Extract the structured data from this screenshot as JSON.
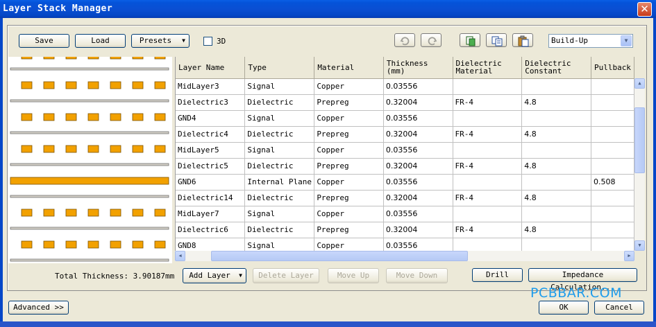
{
  "window": {
    "title": "Layer Stack Manager",
    "close": "✕"
  },
  "toolbar": {
    "save": "Save",
    "load": "Load",
    "presets": "Presets",
    "three_d": "3D",
    "mode": "Build-Up",
    "icons": [
      "undo-icon",
      "redo-icon",
      "copy-icon",
      "paste-icon",
      "clipboard-icon"
    ]
  },
  "grid": {
    "columns": [
      "Layer Name",
      "Type",
      "Material",
      "Thickness (mm)",
      "Dielectric Material",
      "Dielectric Constant",
      "Pullback"
    ],
    "rows": [
      [
        "MidLayer3",
        "Signal",
        "Copper",
        "0.03556",
        "",
        "",
        ""
      ],
      [
        "Dielectric3",
        "Dielectric",
        "Prepreg",
        "0.32004",
        "FR-4",
        "4.8",
        ""
      ],
      [
        "GND4",
        "Signal",
        "Copper",
        "0.03556",
        "",
        "",
        ""
      ],
      [
        "Dielectric4",
        "Dielectric",
        "Prepreg",
        "0.32004",
        "FR-4",
        "4.8",
        ""
      ],
      [
        "MidLayer5",
        "Signal",
        "Copper",
        "0.03556",
        "",
        "",
        ""
      ],
      [
        "Dielectric5",
        "Dielectric",
        "Prepreg",
        "0.32004",
        "FR-4",
        "4.8",
        ""
      ],
      [
        "GND6",
        "Internal Plane",
        "Copper",
        "0.03556",
        "",
        "",
        "0.508"
      ],
      [
        "Dielectric14",
        "Dielectric",
        "Prepreg",
        "0.32004",
        "FR-4",
        "4.8",
        ""
      ],
      [
        "MidLayer7",
        "Signal",
        "Copper",
        "0.03556",
        "",
        "",
        ""
      ],
      [
        "Dielectric6",
        "Dielectric",
        "Prepreg",
        "0.32004",
        "FR-4",
        "4.8",
        ""
      ],
      [
        "GND8",
        "Signal",
        "Copper",
        "0.03556",
        "",
        "",
        ""
      ]
    ]
  },
  "footer": {
    "total_thickness": "Total Thickness: 3.90187mm",
    "add_layer": "Add Layer",
    "delete_layer": "Delete Layer",
    "move_up": "Move Up",
    "move_down": "Move Down",
    "drill": "Drill",
    "impedance": "Impedance Calculation...",
    "advanced": "Advanced >>",
    "ok": "OK",
    "cancel": "Cancel"
  },
  "watermark": "PCBBAR.COM",
  "colors": {
    "copper": "#f2a100",
    "titlebar": "#0a4fd3",
    "watermark": "#1e9bea"
  }
}
